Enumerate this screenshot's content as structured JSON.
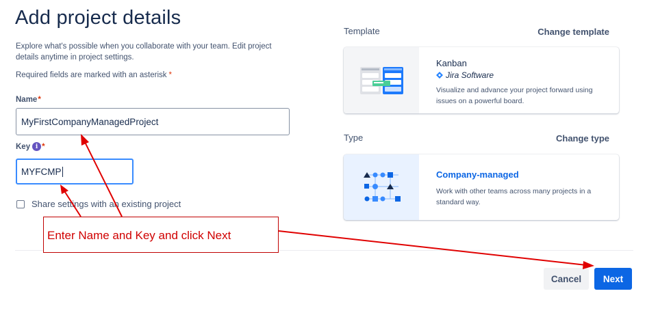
{
  "header": {
    "title": "Add project details",
    "description": "Explore what's possible when you collaborate with your team. Edit project details anytime in project settings.",
    "required_note": "Required fields are marked with an asterisk",
    "asterisk": "*"
  },
  "form": {
    "name_label": "Name",
    "name_value": "MyFirstCompanyManagedProject",
    "key_label": "Key",
    "key_value": "MYFCMP",
    "info_glyph": "i",
    "share_settings_label": "Share settings with an existing project"
  },
  "template": {
    "section_label": "Template",
    "change_label": "Change template",
    "card_title": "Kanban",
    "card_product": "Jira Software",
    "card_description": "Visualize and advance your project forward using issues on a powerful board."
  },
  "type": {
    "section_label": "Type",
    "change_label": "Change type",
    "card_title": "Company-managed",
    "card_description": "Work with other teams across many projects in a standard way."
  },
  "footer": {
    "cancel_label": "Cancel",
    "next_label": "Next"
  },
  "annotation": {
    "callout_text": "Enter Name and Key and click Next",
    "color": "#e00000"
  },
  "colors": {
    "primary": "#0c66e4",
    "focus_border": "#388bff",
    "text": "#172b4d",
    "danger": "#de350b"
  }
}
